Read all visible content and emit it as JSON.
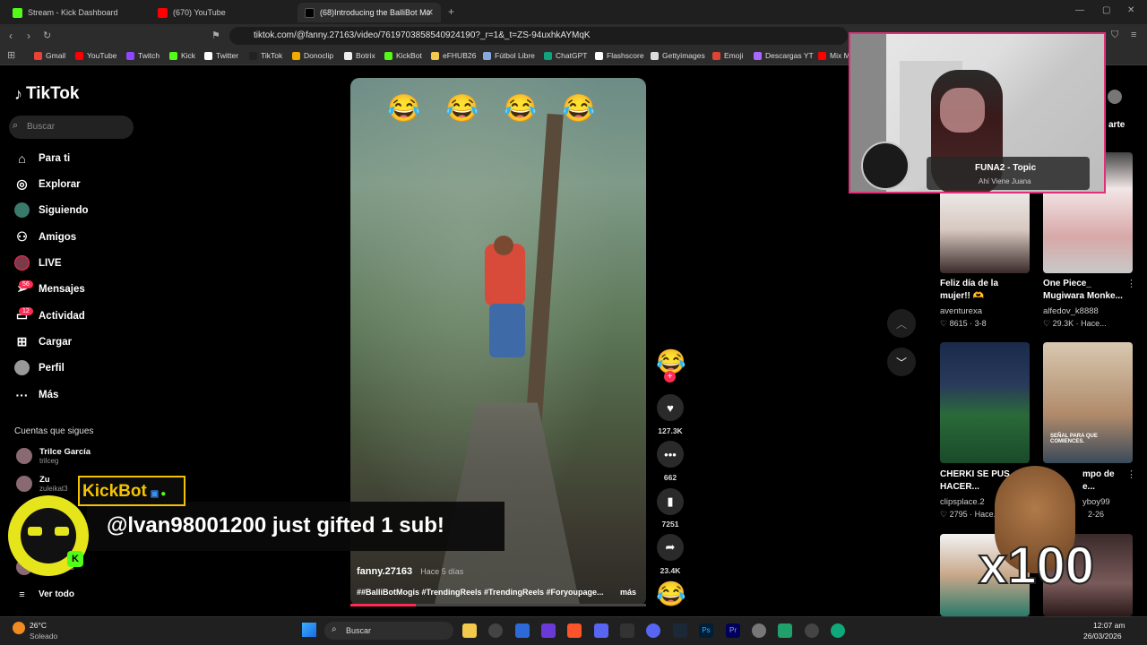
{
  "browser": {
    "tabs": [
      {
        "label": "Stream - Kick Dashboard",
        "active": false
      },
      {
        "label": "(670) YouTube",
        "active": false
      },
      {
        "label": "(68)Introducing the BalliBot Mo",
        "active": true
      }
    ],
    "url": "tiktok.com/@fanny.27163/video/7619703858540924190?_r=1&_t=ZS-94uxhkAYMqK",
    "bookmarks": [
      "Gmail",
      "YouTube",
      "Twitch",
      "Kick",
      "Twitter",
      "TikTok",
      "Donoclip",
      "Botrix",
      "KickBot",
      "eFHUB26",
      "Fútbol Libre",
      "ChatGPT",
      "Flashscore",
      "Gettyimages",
      "Emoji",
      "Descargas YT",
      "Mix M"
    ]
  },
  "tiktok": {
    "logo": "TikTok",
    "search_placeholder": "Buscar",
    "nav": [
      {
        "label": "Para ti",
        "icon": "home-icon"
      },
      {
        "label": "Explorar",
        "icon": "compass-icon"
      },
      {
        "label": "Siguiendo",
        "icon": "following-icon"
      },
      {
        "label": "Amigos",
        "icon": "friends-icon"
      },
      {
        "label": "LIVE",
        "icon": "live-icon"
      },
      {
        "label": "Mensajes",
        "icon": "messages-icon",
        "badge": "56"
      },
      {
        "label": "Actividad",
        "icon": "activity-icon",
        "badge": "12"
      },
      {
        "label": "Cargar",
        "icon": "upload-icon"
      },
      {
        "label": "Perfil",
        "icon": "profile-icon"
      },
      {
        "label": "Más",
        "icon": "more-icon"
      }
    ],
    "following_title": "Cuentas que sigues",
    "following": [
      {
        "name": "Trilce García",
        "handle": "trilceg"
      },
      {
        "name": "Zu",
        "handle": "zuleikat3"
      },
      {
        "name": "",
        "handle": "vielvallejos"
      }
    ],
    "see_all": "Ver todo"
  },
  "video": {
    "user": "fanny.27163",
    "time": "Hace 5 días",
    "caption": "##BalliBotMogis #TrendingReels #TrendingReels #Foryoupage...",
    "more": "más",
    "likes": "127.3K",
    "comments": "662",
    "saves": "7251",
    "shares": "23.4K",
    "progress": 0.22
  },
  "grid": [
    {
      "title1": "Feliz día de la",
      "title2": "mujer!! 🫶",
      "user": "aventurexa",
      "stats": "8615 · 3-8"
    },
    {
      "title1": "One Piece_",
      "title2": "Mugiwara Monke...",
      "user": "alfedov_k8888",
      "stats": "29.3K · Hace..."
    },
    {
      "title1": "CHERKI SE PUS",
      "title2": "HACER...",
      "user": "clipsplace.2",
      "stats": "2795 · Hace..."
    },
    {
      "title1": "mpo de",
      "title2": "e...",
      "user": "yboy99",
      "stats": "2-26"
    }
  ],
  "thumb_labels": {
    "t4": "SEÑAL PARA QUE COMIENCES."
  },
  "stream_overlay": {
    "music_title": "FUNA2 - Topic",
    "music_sub": "Ahí Viene Juana",
    "kickbot_name": "KickBot",
    "kickbot_msg": "@lvan98001200 just gifted 1 sub!",
    "multiplier": "x100",
    "side_label": "arte"
  },
  "taskbar": {
    "temp": "26°C",
    "weather": "Soleado",
    "search": "Buscar",
    "time": "12:07 am",
    "date": "26/03/2026"
  }
}
